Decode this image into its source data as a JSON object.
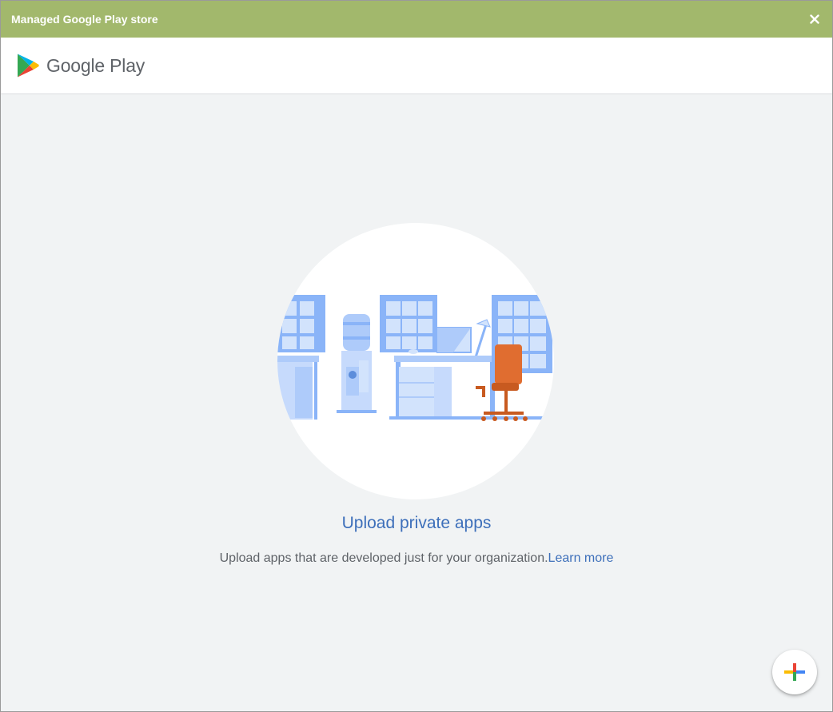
{
  "window": {
    "title": "Managed Google Play store",
    "close_icon": "close-icon"
  },
  "header": {
    "logo_icon": "google-play-logo-icon",
    "brand": "Google Play"
  },
  "empty_state": {
    "illustration": "office-illustration",
    "title": "Upload private apps",
    "description": "Upload apps that are developed just for your organization.",
    "learn_more": "Learn more"
  },
  "fab": {
    "icon": "plus-icon"
  },
  "colors": {
    "titlebar": "#a2b86c",
    "link": "#3d6fba",
    "background": "#f1f3f4"
  }
}
